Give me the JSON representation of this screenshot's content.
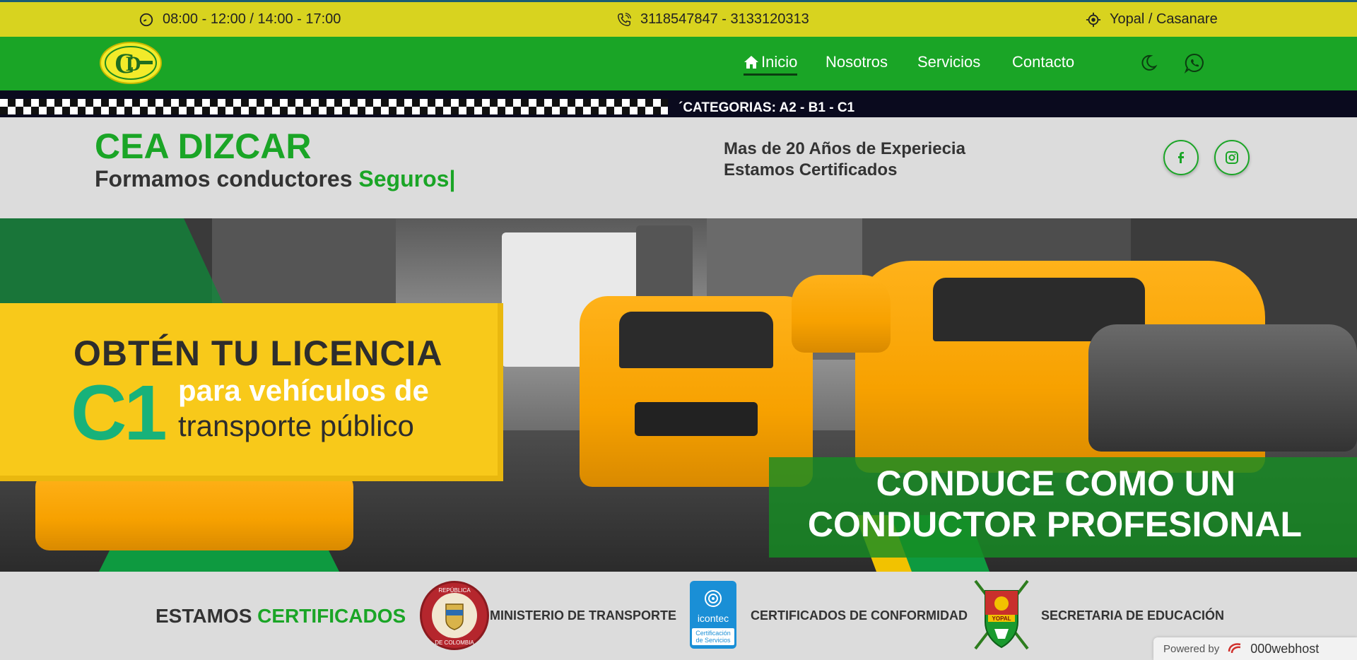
{
  "topbar": {
    "hours": "08:00 - 12:00 / 14:00 - 17:00",
    "phones": "3118547847 - 3133120313",
    "location": "Yopal / Casanare"
  },
  "nav": {
    "links": [
      "Inicio",
      "Nosotros",
      "Servicios",
      "Contacto"
    ],
    "icons": [
      "moon-icon",
      "whatsapp-icon"
    ]
  },
  "strip": {
    "text": "´CATEGORIAS: A2 - B1 - C1"
  },
  "hero": {
    "title": "CEA DIZCAR",
    "subtitle_prefix": "Formamos conductores ",
    "subtitle_accent": "Seguros|",
    "experience_line1": "Mas de 20 Años de Experiecia",
    "experience_line2": "Estamos Certificados"
  },
  "banner": {
    "card_line1": "OBTÉN TU LICENCIA",
    "card_big": "C1",
    "card_line2": "para vehículos de",
    "card_line3": "transporte público",
    "green_line1": "CONDUCE COMO UN",
    "green_line2": "CONDUCTOR PROFESIONAL"
  },
  "certs": {
    "title_prefix": "ESTAMOS ",
    "title_accent": "CERTIFICADOS",
    "ministry": "MINISTERIO DE TRANSPORTE",
    "conformity": "CERTIFICADOS DE CONFORMIDAD",
    "education": "SECRETARIA DE EDUCACIÓN",
    "seal_top": "REPÚBLICA",
    "seal_bottom": "DE COLOMBIA",
    "icontec_name": "icontec",
    "icontec_sub1": "Certificación",
    "icontec_sub2": "de Servicios",
    "yopal_label": "YOPAL"
  },
  "powered": {
    "prefix": "Powered by",
    "brand": "000webhost"
  },
  "colors": {
    "topbar": "#d8d31f",
    "nav": "#1aa526",
    "accent": "#1aa526",
    "card_yellow": "#f8c91a",
    "c1_teal": "#18b27a"
  }
}
